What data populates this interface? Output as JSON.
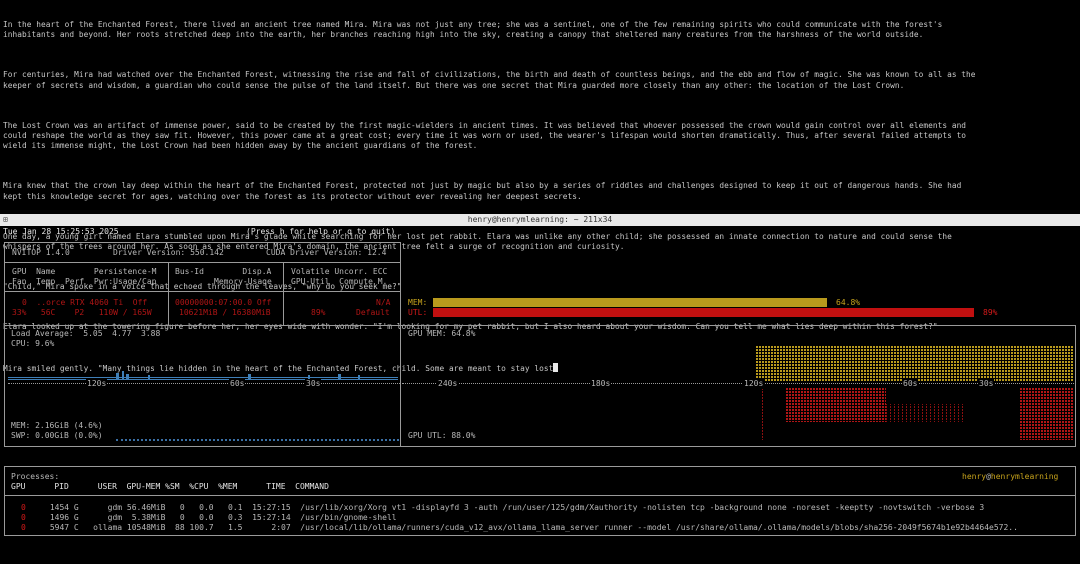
{
  "story": {
    "paragraphs": [
      "In the heart of the Enchanted Forest, there lived an ancient tree named Mira. Mira was not just any tree; she was a sentinel, one of the few remaining spirits who could communicate with the forest's\ninhabitants and beyond. Her roots stretched deep into the earth, her branches reaching high into the sky, creating a canopy that sheltered many creatures from the harshness of the world outside.",
      "For centuries, Mira had watched over the Enchanted Forest, witnessing the rise and fall of civilizations, the birth and death of countless beings, and the ebb and flow of magic. She was known to all as the\nkeeper of secrets and wisdom, a guardian who could sense the pulse of the land itself. But there was one secret that Mira guarded more closely than any other: the location of the Lost Crown.",
      "The Lost Crown was an artifact of immense power, said to be created by the first magic-wielders in ancient times. It was believed that whoever possessed the crown would gain control over all elements and\ncould reshape the world as they saw fit. However, this power came at a great cost; every time it was worn or used, the wearer's lifespan would shorten dramatically. Thus, after several failed attempts to\nwield its immense might, the Lost Crown had been hidden away by the ancient guardians of the forest.",
      "Mira knew that the crown lay deep within the heart of the Enchanted Forest, protected not just by magic but also by a series of riddles and challenges designed to keep it out of dangerous hands. She had\nkept this knowledge secret for ages, watching over the forest as its protector without ever revealing her deepest secrets.",
      "One day, a young girl named Elara stumbled upon Mira's glade while searching for her lost pet rabbit. Elara was unlike any other child; she possessed an innate connection to nature and could sense the\nwhispers of the trees around her. As soon as she entered Mira's domain, the ancient tree felt a surge of recognition and curiosity.",
      "\"Child,\" Mira spoke in a voice that echoed through the leaves, \"why do you seek me?\"",
      "Elara looked up at the towering figure before her, her eyes wide with wonder. \"I'm looking for my pet rabbit, but I also heard about your wisdom. Can you tell me what lies deep within this forest?\"",
      "Mira smiled gently. \"Many things lie hidden in the heart of the Enchanted Forest, child. Some are meant to stay lost"
    ]
  },
  "titlebar": {
    "title": "henry@henrymlearning: ~ 211x34"
  },
  "nvitop": {
    "datetime": "Tue Jan 28 15:25:53 2025",
    "help_hint": "(Press h for help or q to quit)",
    "version": "NVITOP 1.4.0",
    "driver": "Driver Version: 550.142",
    "cuda": "CUDA Driver Version: 12.4",
    "headers": {
      "col1_line1": "GPU  Name        Persistence-M",
      "col1_line2": "Fan  Temp  Perf  Pwr:Usage/Cap",
      "col2_line1": "Bus-Id        Disp.A",
      "col2_line2": "Memory-Usage",
      "col3_line1": "Volatile Uncorr. ECC",
      "col3_line2": "GPU-Util  Compute M."
    },
    "gpu": {
      "row1_col1": "0  ..orce RTX 4060 Ti  Off",
      "row1_col2": "00000000:07:00.0 Off",
      "row1_col3": "N/A",
      "row2_col1": "33%   56C    P2   110W / 165W",
      "row2_col2": "10621MiB / 16380MiB",
      "row2_col3_util": "89%",
      "row2_col3_mode": "Default",
      "mem_label": "MEM:",
      "mem_pct": "64.8%",
      "mem_value": 0.648,
      "utl_label": "UTL:",
      "utl_pct": "89%",
      "utl_value": 0.89
    },
    "host": {
      "load_avg": "Load Average:  5.05  4.77  3.88",
      "cpu": "CPU: 9.6%",
      "mem": "MEM: 2.16GiB (4.6%)",
      "swp": "SWP: 0.00GiB (0.0%)",
      "left_ticks": [
        "120s",
        "60s",
        "30s"
      ],
      "right_ticks": [
        "240s",
        "180s",
        "120s",
        "60s",
        "30s"
      ],
      "gpu_mem": "GPU MEM: 64.8%",
      "gpu_utl": "GPU UTL: 88.0%"
    },
    "processes": {
      "label": "Processes:",
      "user_host_user": "henry",
      "user_host_at": "@",
      "user_host_host": "henrymlearning",
      "columns": "GPU      PID      USER  GPU-MEM %SM  %CPU  %MEM      TIME  COMMAND",
      "rows": [
        {
          "gpu": "0",
          "rest": "1454 G      gdm 56.46MiB   0   0.0   0.1  15:27:15  /usr/lib/xorg/Xorg vt1 -displayfd 3 -auth /run/user/125/gdm/Xauthority -nolisten tcp -background none -noreset -keeptty -novtswitch -verbose 3"
        },
        {
          "gpu": "0",
          "rest": "1496 G      gdm  5.38MiB   0   0.0   0.3  15:27:14  /usr/bin/gnome-shell"
        },
        {
          "gpu": "0",
          "rest": "5947 C   ollama 10548MiB  88 100.7   1.5      2:07  /usr/local/lib/ollama/runners/cuda_v12_avx/ollama_llama_server runner --model /usr/share/ollama/.ollama/models/blobs/sha256-2049f5674b1e92b4464e572.."
        }
      ]
    }
  }
}
